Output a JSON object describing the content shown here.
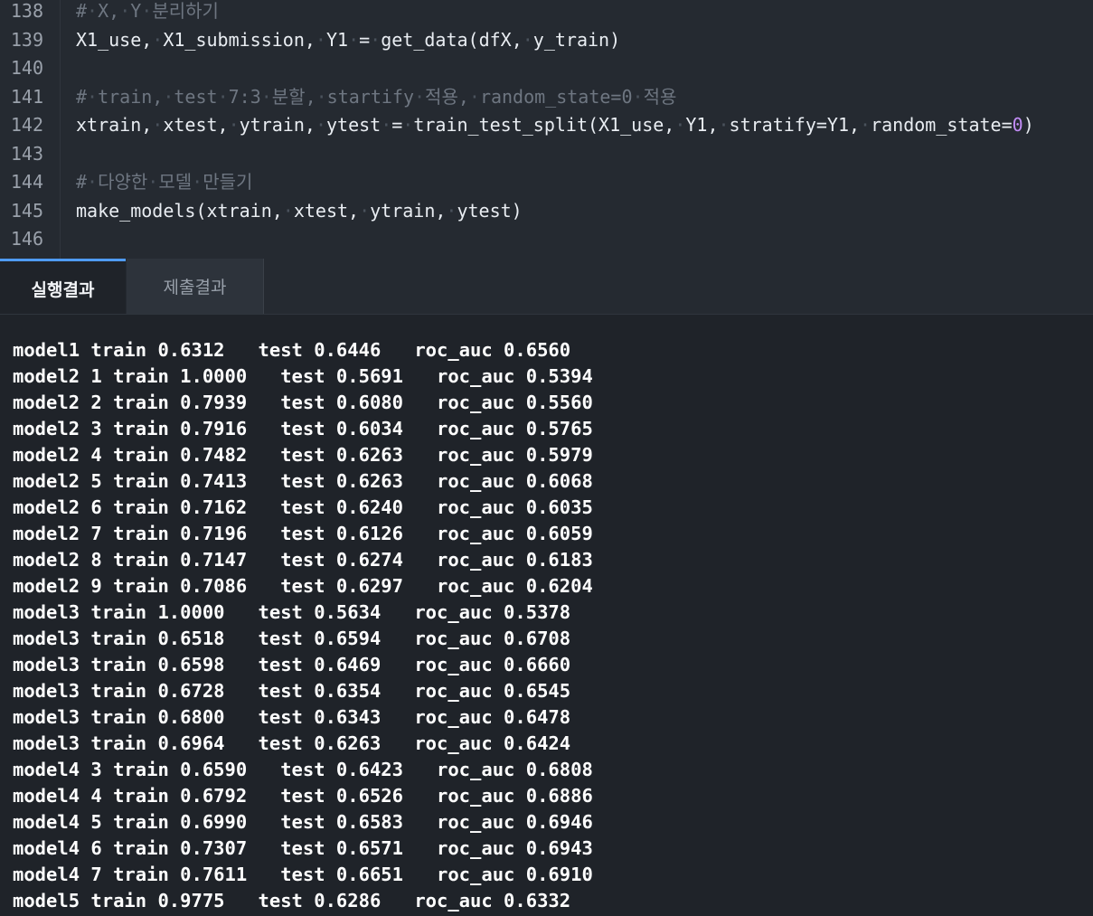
{
  "editor": {
    "line_numbers": [
      "138",
      "139",
      "140",
      "141",
      "142",
      "143",
      "144",
      "145",
      "146"
    ],
    "lines": [
      {
        "text": "# X, Y 분리하기",
        "type": "comment"
      },
      {
        "text": "X1_use, X1_submission, Y1 = get_data(dfX, y_train)",
        "type": "code"
      },
      {
        "text": "",
        "type": "code"
      },
      {
        "text": "# train, test 7:3 분할, startify 적용, random_state=0 적용",
        "type": "comment"
      },
      {
        "text": "xtrain, xtest, ytrain, ytest = train_test_split(X1_use, Y1, stratify=Y1, random_state=0)",
        "type": "code"
      },
      {
        "text": "",
        "type": "code"
      },
      {
        "text": "# 다양한 모델 만들기",
        "type": "comment"
      },
      {
        "text": "make_models(xtrain, xtest, ytrain, ytest)",
        "type": "code"
      },
      {
        "text": "",
        "type": "code"
      }
    ]
  },
  "tabs": {
    "run_result": "실행결과",
    "submit_result": "제출결과"
  },
  "output": {
    "lines": [
      "model1 train 0.6312   test 0.6446   roc_auc 0.6560",
      "model2 1 train 1.0000   test 0.5691   roc_auc 0.5394",
      "model2 2 train 0.7939   test 0.6080   roc_auc 0.5560",
      "model2 3 train 0.7916   test 0.6034   roc_auc 0.5765",
      "model2 4 train 0.7482   test 0.6263   roc_auc 0.5979",
      "model2 5 train 0.7413   test 0.6263   roc_auc 0.6068",
      "model2 6 train 0.7162   test 0.6240   roc_auc 0.6035",
      "model2 7 train 0.7196   test 0.6126   roc_auc 0.6059",
      "model2 8 train 0.7147   test 0.6274   roc_auc 0.6183",
      "model2 9 train 0.7086   test 0.6297   roc_auc 0.6204",
      "model3 train 1.0000   test 0.5634   roc_auc 0.5378",
      "model3 train 0.6518   test 0.6594   roc_auc 0.6708",
      "model3 train 0.6598   test 0.6469   roc_auc 0.6660",
      "model3 train 0.6728   test 0.6354   roc_auc 0.6545",
      "model3 train 0.6800   test 0.6343   roc_auc 0.6478",
      "model3 train 0.6964   test 0.6263   roc_auc 0.6424",
      "model4 3 train 0.6590   test 0.6423   roc_auc 0.6808",
      "model4 4 train 0.6792   test 0.6526   roc_auc 0.6886",
      "model4 5 train 0.6990   test 0.6583   roc_auc 0.6946",
      "model4 6 train 0.7307   test 0.6571   roc_auc 0.6943",
      "model4 7 train 0.7611   test 0.6651   roc_auc 0.6910",
      "model5 train 0.9775   test 0.6286   roc_auc 0.6332"
    ]
  },
  "colors": {
    "editor_bg": "#252a31",
    "output_bg": "#1f2329",
    "comment": "#6e7681",
    "accent_tab": "#4f9bf7",
    "number_literal": "#c18cf5"
  }
}
